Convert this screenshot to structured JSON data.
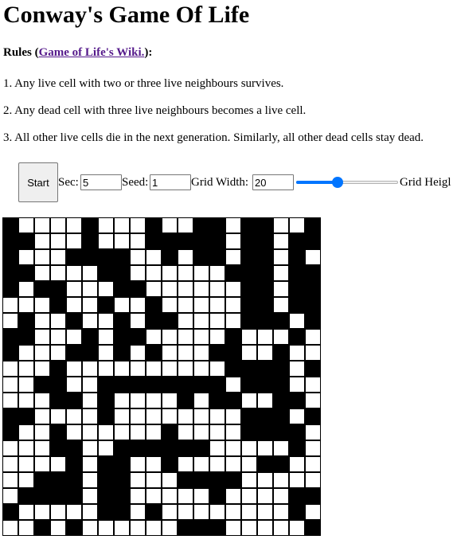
{
  "title": "Conway's Game Of Life",
  "rules": {
    "prefix": "Rules (",
    "link_text": "Game of Life's Wiki.",
    "suffix": "):",
    "items": [
      "1. Any live cell with two or three live neighbours survives.",
      "2. Any dead cell with three live neighbours becomes a live cell.",
      "3. All other live cells die in the next generation. Similarly, all other dead cells stay dead."
    ]
  },
  "controls": {
    "start_label": "Start",
    "sec_label": "Sec:",
    "sec_value": "5",
    "seed_label": "Seed:",
    "seed_value": "1",
    "grid_width_label": "Grid Width:",
    "grid_width_value": "20",
    "slider_level": 0.41,
    "grid_height_label": "Grid Heigl"
  },
  "colors": {
    "link": "#551a8b",
    "accent": "#0075ff",
    "alive": "#000000",
    "dead": "#ffffff"
  },
  "grid": {
    "rows": [
      "10000100010011011001",
      "11000100011111011011",
      "10001111001011011010",
      "11000011000000111011",
      "10110001100000011011",
      "00010010010000011011",
      "01001001011000011101",
      "11000101100000100010",
      "10001101010001100100",
      "00010000000000111101",
      "00110011111111011100",
      "00011010000101100110",
      "11000010000000011101",
      "10010000001000011110",
      "00011001111110000010",
      "00001011001000001100",
      "00111011000111100000",
      "01111011000001000011",
      "10000011010000000010",
      "00101000000111000001"
    ]
  }
}
